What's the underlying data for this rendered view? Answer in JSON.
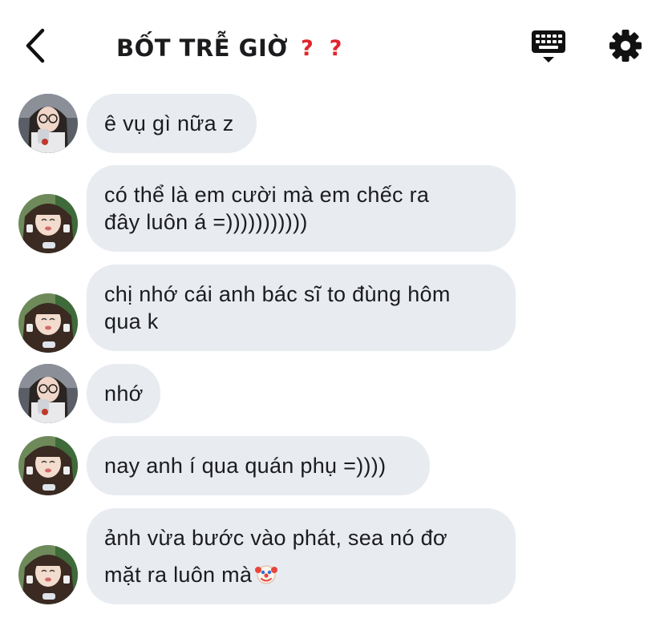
{
  "header": {
    "title": "BỐT TRỄ GIỜ",
    "title_marks": [
      "?",
      "?"
    ],
    "back_icon": "chevron-left-icon",
    "keyboard_icon": "keyboard-icon",
    "settings_icon": "gear-icon",
    "accent_color": "#e0252b"
  },
  "messages": [
    {
      "sender": "avatar-a",
      "lines": [
        "ê vụ gì nữa z"
      ]
    },
    {
      "sender": "avatar-b",
      "lines": [
        "có thể là em cười mà em chếc ra",
        "đây luôn á =)))))))))))"
      ]
    },
    {
      "sender": "avatar-b",
      "lines": [
        "chị nhớ cái anh bác sĩ to đùng hôm",
        "qua k"
      ]
    },
    {
      "sender": "avatar-a",
      "lines": [
        "nhớ"
      ]
    },
    {
      "sender": "avatar-b",
      "lines": [
        "nay anh í qua quán phụ =))))"
      ]
    },
    {
      "sender": "avatar-b",
      "lines": [
        "ảnh vừa bước vào phát, sea nó đơ",
        "mặt ra luôn mà"
      ],
      "trailing_icon": "clown-face-icon"
    }
  ],
  "colors": {
    "bubble_bg": "#e8ebf0",
    "text": "#1c1c1e",
    "background": "#ffffff"
  }
}
